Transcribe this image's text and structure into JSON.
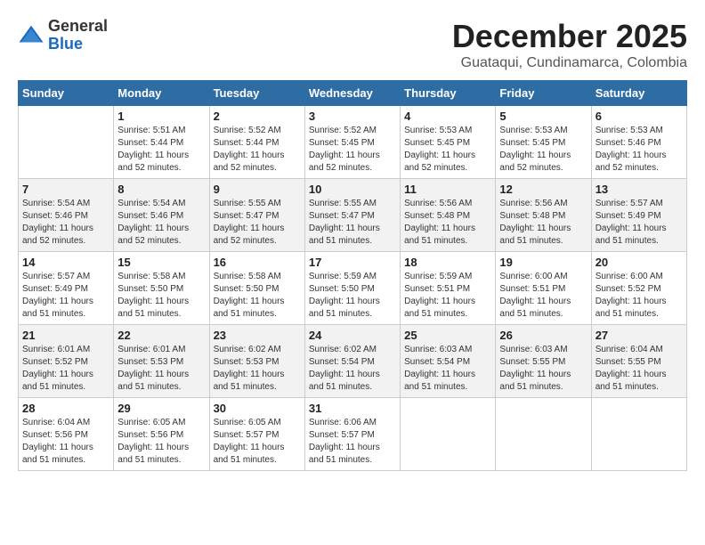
{
  "header": {
    "logo": {
      "line1": "General",
      "line2": "Blue"
    },
    "title": "December 2025",
    "subtitle": "Guataqui, Cundinamarca, Colombia"
  },
  "weekdays": [
    "Sunday",
    "Monday",
    "Tuesday",
    "Wednesday",
    "Thursday",
    "Friday",
    "Saturday"
  ],
  "weeks": [
    [
      {
        "day": "",
        "sunrise": "",
        "sunset": "",
        "daylight": ""
      },
      {
        "day": "1",
        "sunrise": "Sunrise: 5:51 AM",
        "sunset": "Sunset: 5:44 PM",
        "daylight": "Daylight: 11 hours and 52 minutes."
      },
      {
        "day": "2",
        "sunrise": "Sunrise: 5:52 AM",
        "sunset": "Sunset: 5:44 PM",
        "daylight": "Daylight: 11 hours and 52 minutes."
      },
      {
        "day": "3",
        "sunrise": "Sunrise: 5:52 AM",
        "sunset": "Sunset: 5:45 PM",
        "daylight": "Daylight: 11 hours and 52 minutes."
      },
      {
        "day": "4",
        "sunrise": "Sunrise: 5:53 AM",
        "sunset": "Sunset: 5:45 PM",
        "daylight": "Daylight: 11 hours and 52 minutes."
      },
      {
        "day": "5",
        "sunrise": "Sunrise: 5:53 AM",
        "sunset": "Sunset: 5:45 PM",
        "daylight": "Daylight: 11 hours and 52 minutes."
      },
      {
        "day": "6",
        "sunrise": "Sunrise: 5:53 AM",
        "sunset": "Sunset: 5:46 PM",
        "daylight": "Daylight: 11 hours and 52 minutes."
      }
    ],
    [
      {
        "day": "7",
        "sunrise": "Sunrise: 5:54 AM",
        "sunset": "Sunset: 5:46 PM",
        "daylight": "Daylight: 11 hours and 52 minutes."
      },
      {
        "day": "8",
        "sunrise": "Sunrise: 5:54 AM",
        "sunset": "Sunset: 5:46 PM",
        "daylight": "Daylight: 11 hours and 52 minutes."
      },
      {
        "day": "9",
        "sunrise": "Sunrise: 5:55 AM",
        "sunset": "Sunset: 5:47 PM",
        "daylight": "Daylight: 11 hours and 52 minutes."
      },
      {
        "day": "10",
        "sunrise": "Sunrise: 5:55 AM",
        "sunset": "Sunset: 5:47 PM",
        "daylight": "Daylight: 11 hours and 51 minutes."
      },
      {
        "day": "11",
        "sunrise": "Sunrise: 5:56 AM",
        "sunset": "Sunset: 5:48 PM",
        "daylight": "Daylight: 11 hours and 51 minutes."
      },
      {
        "day": "12",
        "sunrise": "Sunrise: 5:56 AM",
        "sunset": "Sunset: 5:48 PM",
        "daylight": "Daylight: 11 hours and 51 minutes."
      },
      {
        "day": "13",
        "sunrise": "Sunrise: 5:57 AM",
        "sunset": "Sunset: 5:49 PM",
        "daylight": "Daylight: 11 hours and 51 minutes."
      }
    ],
    [
      {
        "day": "14",
        "sunrise": "Sunrise: 5:57 AM",
        "sunset": "Sunset: 5:49 PM",
        "daylight": "Daylight: 11 hours and 51 minutes."
      },
      {
        "day": "15",
        "sunrise": "Sunrise: 5:58 AM",
        "sunset": "Sunset: 5:50 PM",
        "daylight": "Daylight: 11 hours and 51 minutes."
      },
      {
        "day": "16",
        "sunrise": "Sunrise: 5:58 AM",
        "sunset": "Sunset: 5:50 PM",
        "daylight": "Daylight: 11 hours and 51 minutes."
      },
      {
        "day": "17",
        "sunrise": "Sunrise: 5:59 AM",
        "sunset": "Sunset: 5:50 PM",
        "daylight": "Daylight: 11 hours and 51 minutes."
      },
      {
        "day": "18",
        "sunrise": "Sunrise: 5:59 AM",
        "sunset": "Sunset: 5:51 PM",
        "daylight": "Daylight: 11 hours and 51 minutes."
      },
      {
        "day": "19",
        "sunrise": "Sunrise: 6:00 AM",
        "sunset": "Sunset: 5:51 PM",
        "daylight": "Daylight: 11 hours and 51 minutes."
      },
      {
        "day": "20",
        "sunrise": "Sunrise: 6:00 AM",
        "sunset": "Sunset: 5:52 PM",
        "daylight": "Daylight: 11 hours and 51 minutes."
      }
    ],
    [
      {
        "day": "21",
        "sunrise": "Sunrise: 6:01 AM",
        "sunset": "Sunset: 5:52 PM",
        "daylight": "Daylight: 11 hours and 51 minutes."
      },
      {
        "day": "22",
        "sunrise": "Sunrise: 6:01 AM",
        "sunset": "Sunset: 5:53 PM",
        "daylight": "Daylight: 11 hours and 51 minutes."
      },
      {
        "day": "23",
        "sunrise": "Sunrise: 6:02 AM",
        "sunset": "Sunset: 5:53 PM",
        "daylight": "Daylight: 11 hours and 51 minutes."
      },
      {
        "day": "24",
        "sunrise": "Sunrise: 6:02 AM",
        "sunset": "Sunset: 5:54 PM",
        "daylight": "Daylight: 11 hours and 51 minutes."
      },
      {
        "day": "25",
        "sunrise": "Sunrise: 6:03 AM",
        "sunset": "Sunset: 5:54 PM",
        "daylight": "Daylight: 11 hours and 51 minutes."
      },
      {
        "day": "26",
        "sunrise": "Sunrise: 6:03 AM",
        "sunset": "Sunset: 5:55 PM",
        "daylight": "Daylight: 11 hours and 51 minutes."
      },
      {
        "day": "27",
        "sunrise": "Sunrise: 6:04 AM",
        "sunset": "Sunset: 5:55 PM",
        "daylight": "Daylight: 11 hours and 51 minutes."
      }
    ],
    [
      {
        "day": "28",
        "sunrise": "Sunrise: 6:04 AM",
        "sunset": "Sunset: 5:56 PM",
        "daylight": "Daylight: 11 hours and 51 minutes."
      },
      {
        "day": "29",
        "sunrise": "Sunrise: 6:05 AM",
        "sunset": "Sunset: 5:56 PM",
        "daylight": "Daylight: 11 hours and 51 minutes."
      },
      {
        "day": "30",
        "sunrise": "Sunrise: 6:05 AM",
        "sunset": "Sunset: 5:57 PM",
        "daylight": "Daylight: 11 hours and 51 minutes."
      },
      {
        "day": "31",
        "sunrise": "Sunrise: 6:06 AM",
        "sunset": "Sunset: 5:57 PM",
        "daylight": "Daylight: 11 hours and 51 minutes."
      },
      {
        "day": "",
        "sunrise": "",
        "sunset": "",
        "daylight": ""
      },
      {
        "day": "",
        "sunrise": "",
        "sunset": "",
        "daylight": ""
      },
      {
        "day": "",
        "sunrise": "",
        "sunset": "",
        "daylight": ""
      }
    ]
  ]
}
